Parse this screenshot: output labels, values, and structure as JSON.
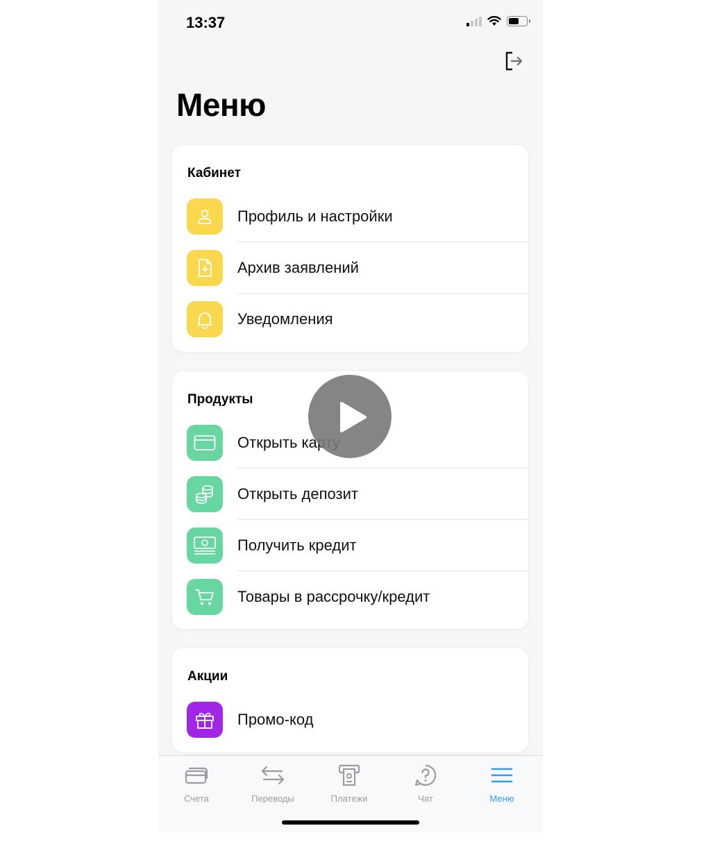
{
  "status_bar": {
    "time": "13:37"
  },
  "header": {
    "title": "Меню"
  },
  "sections": [
    {
      "title": "Кабинет",
      "items": [
        {
          "label": "Профиль и настройки",
          "icon": "person-icon"
        },
        {
          "label": "Архив заявлений",
          "icon": "document-add-icon"
        },
        {
          "label": "Уведомления",
          "icon": "bell-icon"
        }
      ]
    },
    {
      "title": "Продукты",
      "items": [
        {
          "label": "Открыть карту",
          "icon": "card-icon"
        },
        {
          "label": "Открыть депозит",
          "icon": "coins-icon"
        },
        {
          "label": "Получить кредит",
          "icon": "cash-icon"
        },
        {
          "label": "Товары в рассрочку/кредит",
          "icon": "cart-icon"
        }
      ]
    },
    {
      "title": "Акции",
      "items": [
        {
          "label": "Промо-код",
          "icon": "gift-icon"
        }
      ]
    }
  ],
  "tabbar": [
    {
      "label": "Счета",
      "icon": "accounts-icon",
      "active": false
    },
    {
      "label": "Переводы",
      "icon": "transfer-arrows-icon",
      "active": false
    },
    {
      "label": "Платежи",
      "icon": "payment-terminal-icon",
      "active": false
    },
    {
      "label": "Чат",
      "icon": "chat-question-icon",
      "active": false
    },
    {
      "label": "Меню",
      "icon": "hamburger-menu-icon",
      "active": true
    }
  ],
  "colors": {
    "yellow": "#fad84e",
    "green": "#67d6a0",
    "purple": "#a126e6",
    "active_tab": "#2d9ee8"
  }
}
